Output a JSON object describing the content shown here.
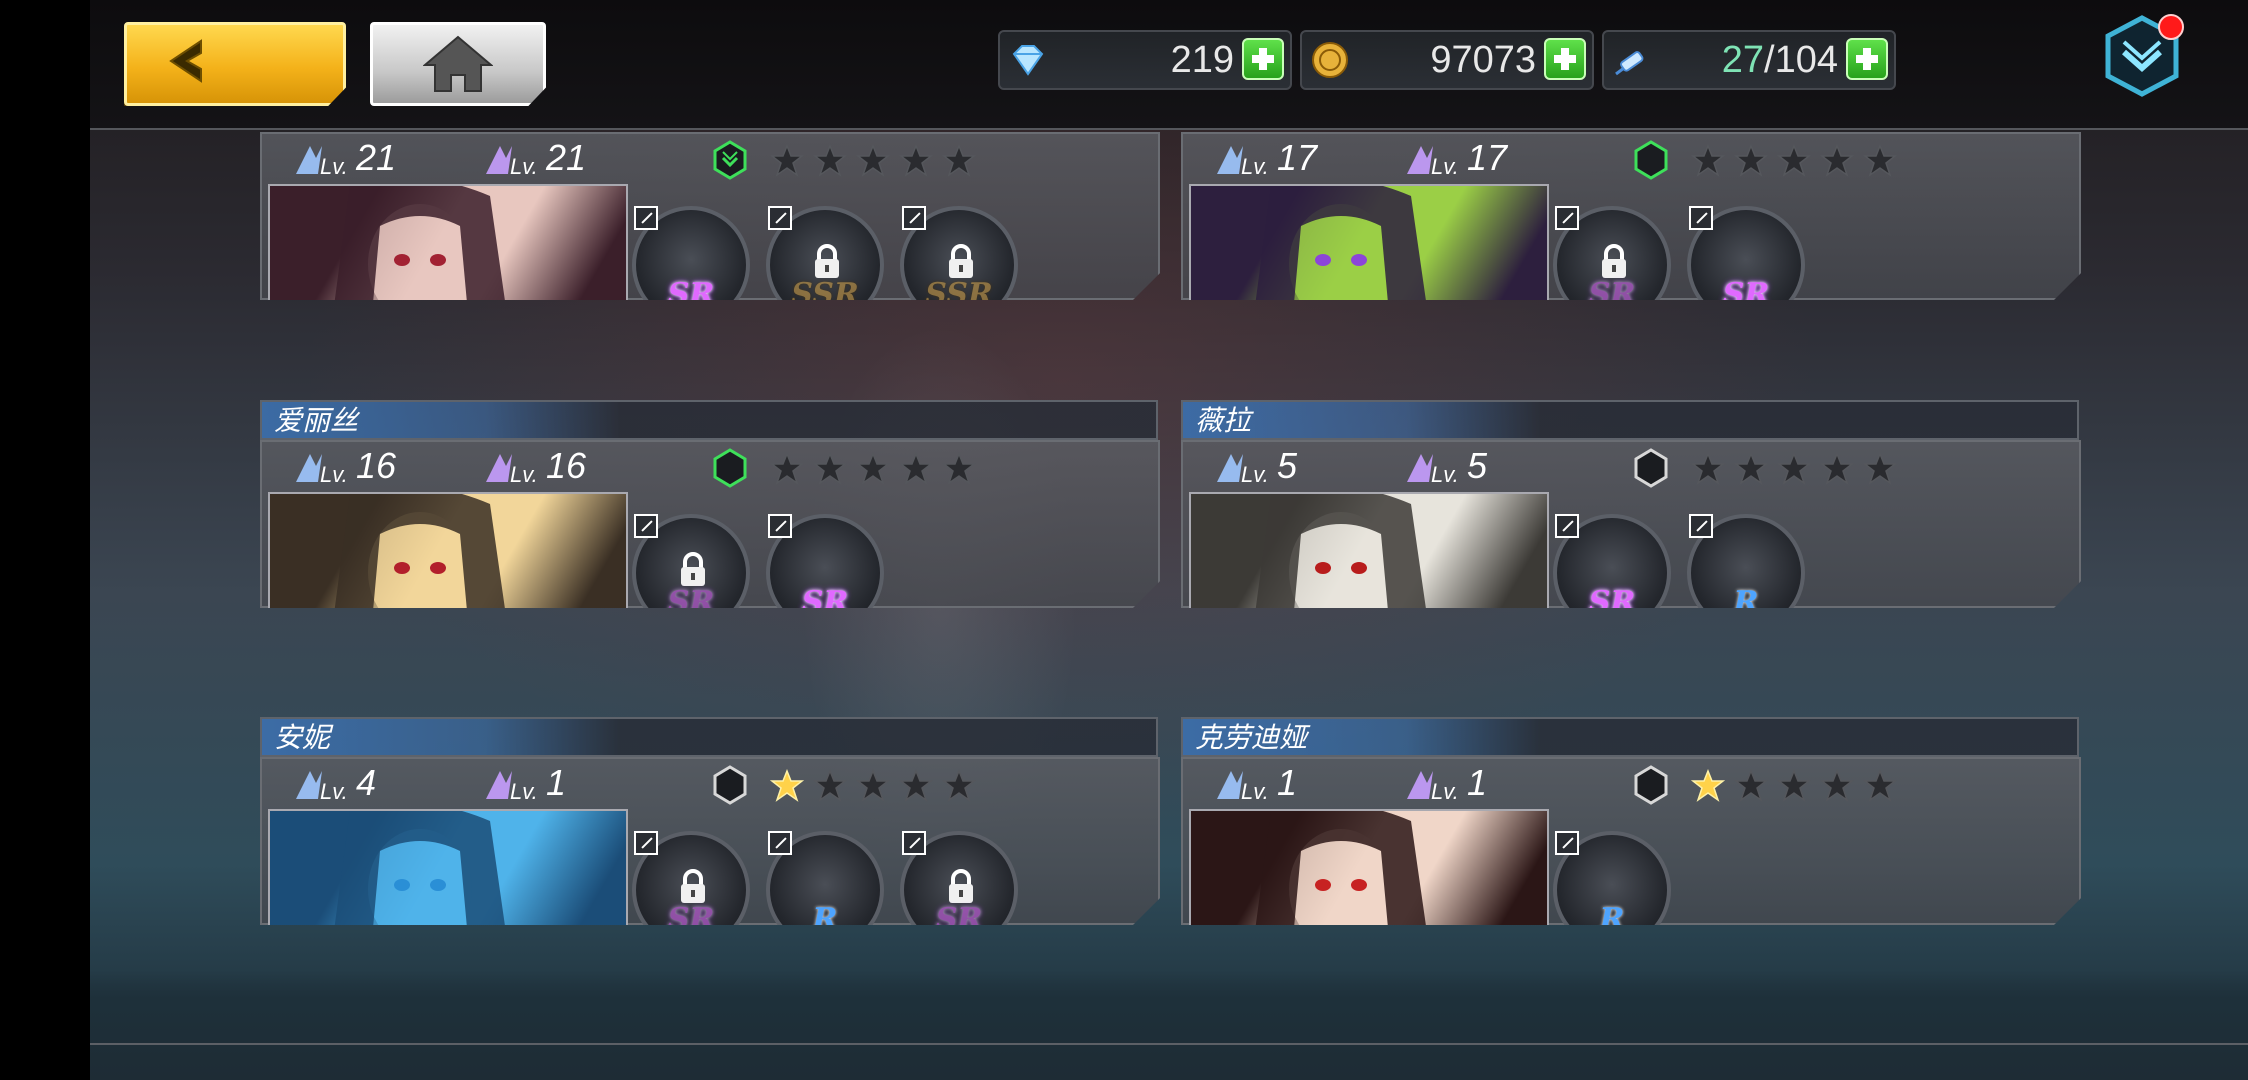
{
  "topbar": {
    "back_icon": "chevron-left-icon",
    "home_icon": "home-icon",
    "resources": [
      {
        "name": "diamond",
        "icon": "diamond-icon",
        "value": "219"
      },
      {
        "name": "gold",
        "icon": "gold-coin-icon",
        "value": "97073"
      },
      {
        "name": "stamina",
        "icon": "syringe-icon",
        "current": "27",
        "sep": "/",
        "max": "104"
      }
    ],
    "notify_icon": "badge-check-icon"
  },
  "cards": [
    {
      "name": "",
      "lv1": "21",
      "lv2": "21",
      "stage": "green-active",
      "stars": 0,
      "portrait_colors": [
        "#3b1f2a",
        "#e8c7bf",
        "#a22233"
      ],
      "weapons": [
        {
          "locked": false,
          "rarity": "SR"
        },
        {
          "locked": true,
          "rarity": "SSR"
        },
        {
          "locked": true,
          "rarity": "SSR"
        }
      ]
    },
    {
      "name": "",
      "lv1": "17",
      "lv2": "17",
      "stage": "green",
      "stars": 0,
      "portrait_colors": [
        "#2d1f3e",
        "#9bcf46",
        "#8c45d9"
      ],
      "weapons": [
        {
          "locked": true,
          "rarity": "SR"
        },
        {
          "locked": false,
          "rarity": "SR"
        }
      ]
    },
    {
      "name": "爱丽丝",
      "lv1": "16",
      "lv2": "16",
      "stage": "green",
      "stars": 0,
      "portrait_colors": [
        "#3a2f24",
        "#f2d69a",
        "#b21f2b"
      ],
      "weapons": [
        {
          "locked": true,
          "rarity": "SR"
        },
        {
          "locked": false,
          "rarity": "SR"
        }
      ]
    },
    {
      "name": "薇拉",
      "lv1": "5",
      "lv2": "5",
      "stage": "white",
      "stars": 0,
      "portrait_colors": [
        "#3c3a36",
        "#e7e4dc",
        "#b81c1c"
      ],
      "weapons": [
        {
          "locked": false,
          "rarity": "SR"
        },
        {
          "locked": false,
          "rarity": "R"
        }
      ]
    },
    {
      "name": "安妮",
      "lv1": "4",
      "lv2": "1",
      "stage": "white",
      "stars": 1,
      "portrait_colors": [
        "#1b4d78",
        "#4fb3ea",
        "#2a8fd6"
      ],
      "weapons": [
        {
          "locked": true,
          "rarity": "SR"
        },
        {
          "locked": false,
          "rarity": "R"
        },
        {
          "locked": true,
          "rarity": "SR"
        }
      ]
    },
    {
      "name": "克劳迪娅",
      "lv1": "1",
      "lv2": "1",
      "stage": "white",
      "stars": 1,
      "portrait_colors": [
        "#2b1616",
        "#f0d6c8",
        "#c72222"
      ],
      "weapons": [
        {
          "locked": false,
          "rarity": "R"
        }
      ]
    }
  ],
  "colors": {
    "accent_gold": "#f4b21a",
    "plus_green": "#27a21b",
    "stage_green": "#3ee05a",
    "sr_purple": "#e069ff",
    "ssr_gold": "#d8a64a",
    "r_blue": "#4ea4ff"
  }
}
